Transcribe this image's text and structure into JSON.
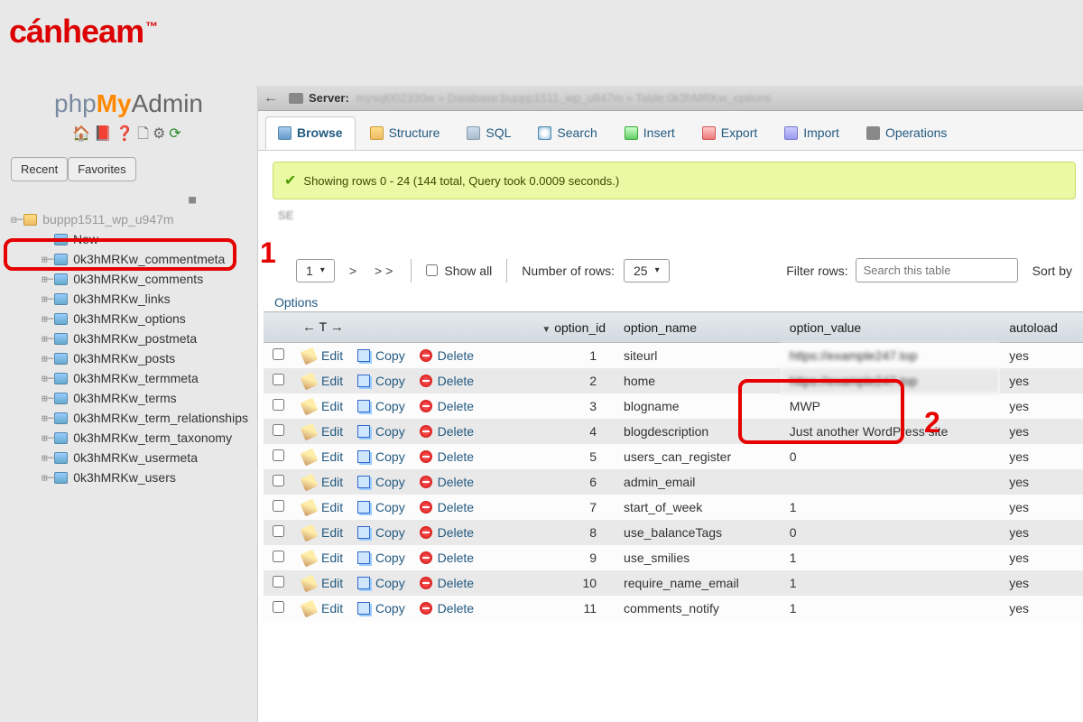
{
  "watermark": "cánheam",
  "pma": {
    "p1": "php",
    "p2": "My",
    "p3": "Admin"
  },
  "sidebar": {
    "recent": "Recent",
    "favorites": "Favorites",
    "dbname": "buppp1511_wp_u947m",
    "new": "New",
    "tables": [
      "0k3hMRKw_commentmeta",
      "0k3hMRKw_comments",
      "0k3hMRKw_links",
      "0k3hMRKw_options",
      "0k3hMRKw_postmeta",
      "0k3hMRKw_posts",
      "0k3hMRKw_termmeta",
      "0k3hMRKw_terms",
      "0k3hMRKw_term_relationships",
      "0k3hMRKw_term_taxonomy",
      "0k3hMRKw_usermeta",
      "0k3hMRKw_users"
    ]
  },
  "breadcrumb": {
    "server": "Server:"
  },
  "tabs": {
    "browse": "Browse",
    "structure": "Structure",
    "sql": "SQL",
    "search": "Search",
    "insert": "Insert",
    "export": "Export",
    "import": "Import",
    "operations": "Operations"
  },
  "success": "Showing rows 0 - 24 (144 total, Query took 0.0009 seconds.)",
  "se": "SE",
  "controls": {
    "page": "1",
    "next": ">",
    "last": ">>",
    "show_all": "Show all",
    "num_rows_label": "Number of rows:",
    "num_rows_value": "25",
    "filter_label": "Filter rows:",
    "search_placeholder": "Search this table",
    "sort_by": "Sort by"
  },
  "options_caption": "Options",
  "headers": {
    "option_id": "option_id",
    "option_name": "option_name",
    "option_value": "option_value",
    "autoload": "autoload"
  },
  "actions": {
    "edit": "Edit",
    "copy": "Copy",
    "delete": "Delete"
  },
  "rows": [
    {
      "id": "1",
      "name": "siteurl",
      "value": "https://example247.top",
      "value_blur": true,
      "autoload": "yes"
    },
    {
      "id": "2",
      "name": "home",
      "value": "https://example247.top",
      "value_blur": true,
      "autoload": "yes"
    },
    {
      "id": "3",
      "name": "blogname",
      "value": "MWP",
      "autoload": "yes"
    },
    {
      "id": "4",
      "name": "blogdescription",
      "value": "Just another WordPress site",
      "autoload": "yes"
    },
    {
      "id": "5",
      "name": "users_can_register",
      "value": "0",
      "autoload": "yes"
    },
    {
      "id": "6",
      "name": "admin_email",
      "value": "",
      "autoload": "yes"
    },
    {
      "id": "7",
      "name": "start_of_week",
      "value": "1",
      "autoload": "yes"
    },
    {
      "id": "8",
      "name": "use_balanceTags",
      "value": "0",
      "autoload": "yes"
    },
    {
      "id": "9",
      "name": "use_smilies",
      "value": "1",
      "autoload": "yes"
    },
    {
      "id": "10",
      "name": "require_name_email",
      "value": "1",
      "autoload": "yes"
    },
    {
      "id": "11",
      "name": "comments_notify",
      "value": "1",
      "autoload": "yes"
    }
  ],
  "annotations": {
    "one": "1",
    "two": "2"
  },
  "selected_table_index": 3
}
